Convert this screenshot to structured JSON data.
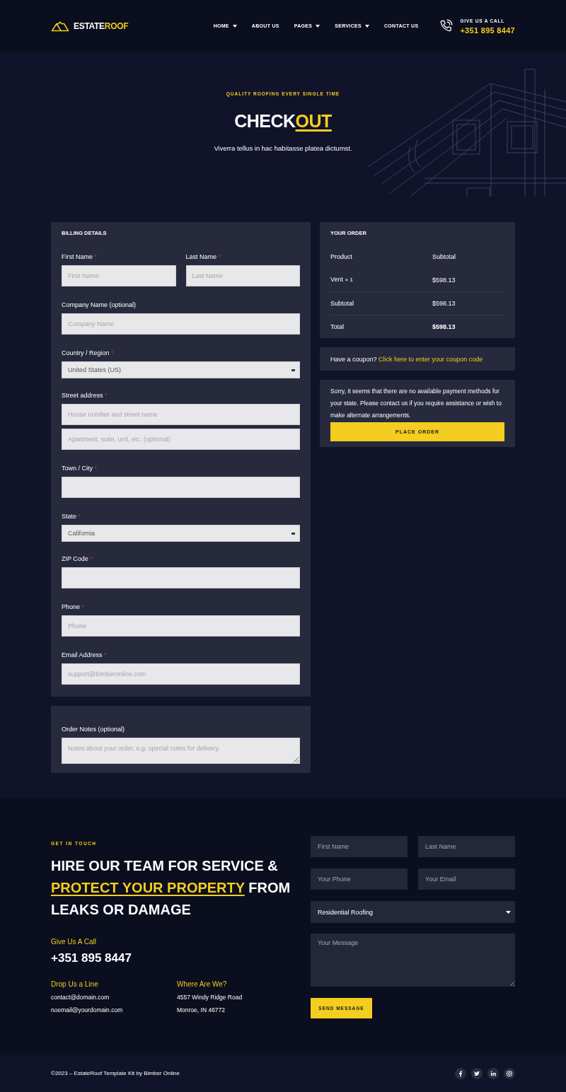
{
  "header": {
    "logo": {
      "text": "ESTATE",
      "highlight": "ROOF"
    },
    "nav": [
      {
        "label": "HOME",
        "has_menu": true
      },
      {
        "label": "ABOUT US",
        "has_menu": false
      },
      {
        "label": "PAGES",
        "has_menu": true
      },
      {
        "label": "SERVICES",
        "has_menu": true
      },
      {
        "label": "CONTACT US",
        "has_menu": false
      }
    ],
    "call": {
      "label": "GIVE US A CALL",
      "phone": "+351 895 8447"
    }
  },
  "hero": {
    "tagline": "QUALITY ROOFING EVERY SINGLE TIME",
    "title": {
      "text": "CHECK",
      "highlight": "OUT"
    },
    "subtitle": "Viverra tellus in hac habitasse platea dictumst."
  },
  "billing": {
    "title": "BILLING DETAILS",
    "rows": [
      [
        {
          "kind": "text",
          "label": "First Name",
          "required_mark": "*",
          "placeholder": "First Name"
        },
        {
          "kind": "text",
          "label": "Last Name",
          "required_mark": "*",
          "placeholder": "Last Name"
        }
      ],
      [
        {
          "kind": "text",
          "label": "Company Name (optional)",
          "placeholder": "Company Name"
        }
      ],
      [
        {
          "kind": "select",
          "label": "Country / Region",
          "required_mark": "*",
          "value": "United States (US)"
        }
      ],
      [
        {
          "kind": "text",
          "label": "Street address",
          "required_mark": "*",
          "inputs": [
            {
              "placeholder": "House number and street name"
            },
            {
              "placeholder": "Apartment, suite, unit, etc. (optional)"
            }
          ]
        }
      ],
      [
        {
          "kind": "text",
          "label": "Town / City",
          "required_mark": "*"
        }
      ],
      [
        {
          "kind": "select",
          "label": "State",
          "required_mark": "*",
          "value": "California"
        }
      ],
      [
        {
          "kind": "text",
          "label": "ZIP Code",
          "required_mark": "*"
        }
      ],
      [
        {
          "kind": "text",
          "label": "Phone",
          "required_mark": "*",
          "placeholder": "Phone"
        }
      ],
      [
        {
          "kind": "text",
          "label": "Email Address",
          "required_mark": "*",
          "placeholder": "support@bimberonline.com"
        }
      ]
    ]
  },
  "order_notes": {
    "label": "Order Notes (optional)",
    "placeholder": "Notes about your order, e.g. special notes for delivery."
  },
  "order": {
    "title": "YOUR ORDER",
    "columns": [
      "Product",
      "Subtotal"
    ],
    "rows": [
      {
        "kind": "item",
        "label": "Vent",
        "quantity": "× 1",
        "amount": "$598.13"
      },
      {
        "kind": "subtotal",
        "label": "Subtotal",
        "amount": "$598.13"
      },
      {
        "kind": "total",
        "label": "Total",
        "amount": "$598.13"
      }
    ]
  },
  "coupon": {
    "text": "Have a coupon?",
    "link": "Click here to enter your coupon code"
  },
  "payment": {
    "notice": "Sorry, it seems that there are no available payment methods for your state. Please contact us if you require assistance or wish to make alternate arrangements.",
    "button": "PLACE ORDER"
  },
  "contact": {
    "eyebrow": "GET IN TOUCH",
    "heading": {
      "before": "HIRE OUR TEAM FOR SERVICE &",
      "highlight": "PROTECT YOUR PROPERTY",
      "after": "FROM LEAKS OR DAMAGE"
    },
    "call": {
      "label": "Give Us A Call",
      "phone": "+351 895 8447"
    },
    "info": [
      {
        "title": "Drop Us a Line",
        "lines": [
          "contact@domain.com",
          "noemail@yourdomain.com"
        ]
      },
      {
        "title": "Where Are We?",
        "lines": [
          "4557 Windy Ridge Road",
          "Monroe, IN 46772"
        ]
      }
    ],
    "form": {
      "fields": [
        {
          "kind": "text",
          "placeholder": "First Name"
        },
        {
          "kind": "text",
          "placeholder": "Last Name"
        },
        {
          "kind": "text",
          "placeholder": "Your Phone"
        },
        {
          "kind": "text",
          "placeholder": "Your Email"
        },
        {
          "kind": "select",
          "value": "Residential Roofing"
        },
        {
          "kind": "textarea",
          "placeholder": "Your Message"
        }
      ],
      "button": "SEND MESSAGE"
    }
  },
  "footer": {
    "copyright": "©2023 – EstateRoof Template Kit by Bimber Online"
  }
}
